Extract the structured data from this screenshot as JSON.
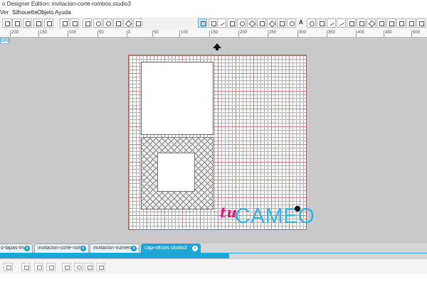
{
  "window": {
    "title": "o Designer Edition: invitacion-corte-rombos.studio3"
  },
  "menu": [
    "Ver",
    "Silhouette",
    "Objeto",
    "Ayuda"
  ],
  "toolbar": {
    "text_tool_label": "A"
  },
  "ruler": {
    "ticks": [
      "200",
      "150",
      "100",
      "50",
      "0",
      "50",
      "100",
      "150",
      "200",
      "250",
      "300",
      "350",
      "400",
      "450",
      "500"
    ]
  },
  "corner_tag": "DPO",
  "brand": {
    "prefix": "tu",
    "name": "CAMEO"
  },
  "tabs": [
    {
      "label": "o-tapas-im...",
      "close": "x",
      "active": false
    },
    {
      "label": "invitacion-corte-rom...",
      "close": "x",
      "active": false
    },
    {
      "label": "invitacion-numeros...",
      "close": "x",
      "active": false
    },
    {
      "label": "caja-oficios.studio3",
      "close": "x",
      "active": true
    }
  ],
  "colors": {
    "accent": "#1ea7d6",
    "brand_pink": "#e6157f",
    "brand_blue": "#2bb7e8",
    "grid_red": "#d75050"
  }
}
